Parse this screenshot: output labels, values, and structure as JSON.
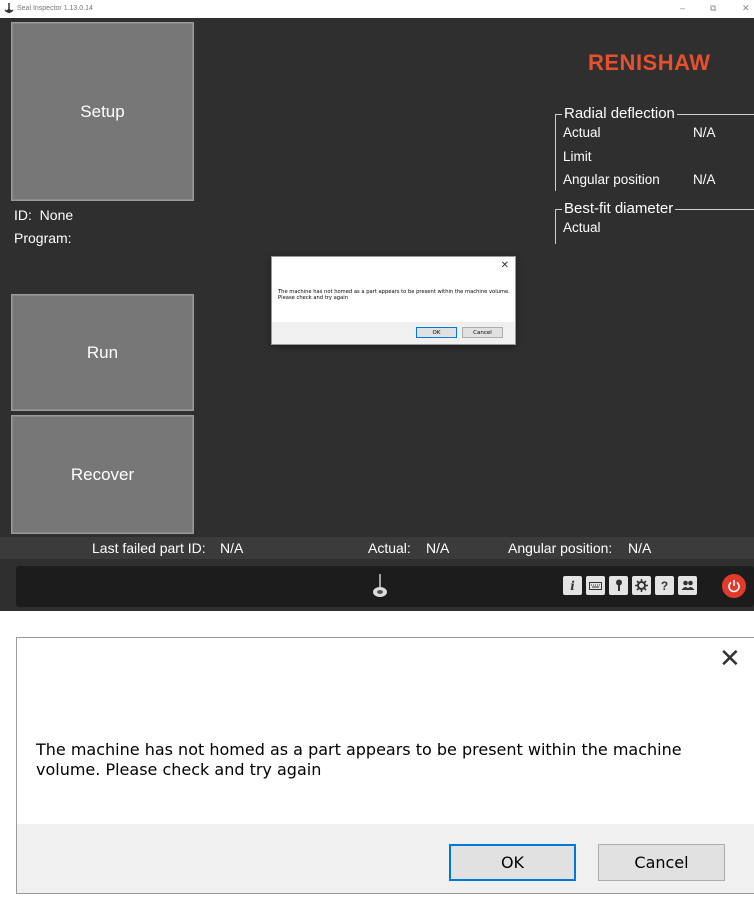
{
  "window": {
    "title": "Seal Inspector 1.13.0.14",
    "minimize_glyph": "–",
    "restore_glyph": "⧉",
    "close_glyph": "✕"
  },
  "tiles": {
    "setup": "Setup",
    "run": "Run",
    "recover": "Recover"
  },
  "info": {
    "id_label": "ID:",
    "id_value": "None",
    "program_label": "Program:"
  },
  "brand": {
    "logo_text": "RENISHAW",
    "logo_color": "#e7502f"
  },
  "radial_deflection": {
    "title": "Radial deflection",
    "actual_label": "Actual",
    "actual_value": "N/A",
    "limit_label": "Limit",
    "angular_label": "Angular position",
    "angular_value": "N/A"
  },
  "best_fit": {
    "title": "Best-fit diameter",
    "actual_label": "Actual"
  },
  "statusbar": {
    "last_failed_label": "Last failed part ID:",
    "last_failed_value": "N/A",
    "actual_label": "Actual:",
    "actual_value": "N/A",
    "angular_label": "Angular position:",
    "angular_value": "N/A"
  },
  "toolbar": {
    "icons": [
      "info-icon",
      "keyboard-icon",
      "key-icon",
      "gear-icon",
      "help-icon",
      "users-icon",
      "power-icon"
    ],
    "info_glyph": "i",
    "help_glyph": "?"
  },
  "dialog": {
    "message": "The machine has not homed as a part appears to be present within the machine volume. Please check and try again",
    "ok_label": "OK",
    "cancel_label": "Cancel",
    "close_glyph": "✕"
  }
}
